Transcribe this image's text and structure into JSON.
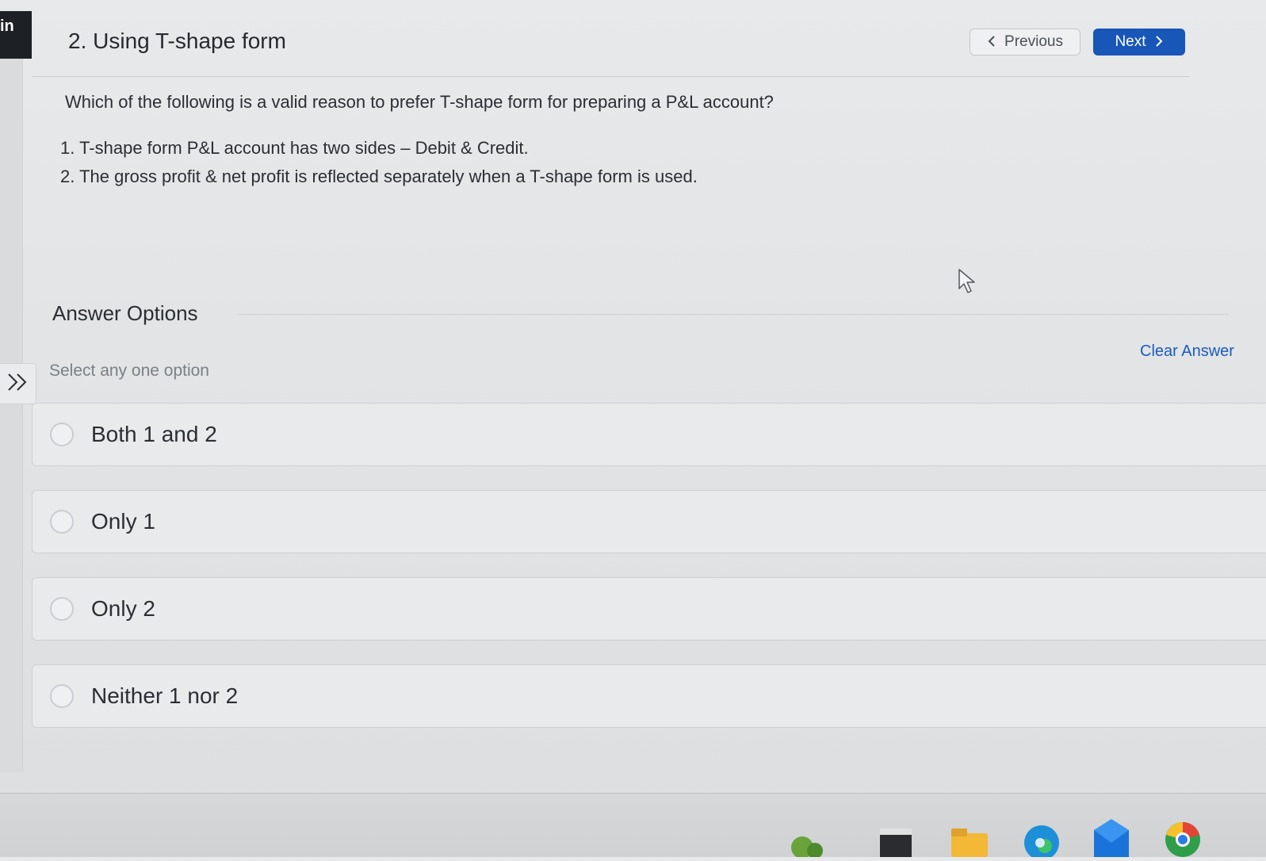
{
  "left_badge": {
    "text": "in"
  },
  "header": {
    "title": "2. Using T-shape form",
    "previous_label": "Previous",
    "next_label": "Next"
  },
  "question": {
    "text": "Which of the following is a valid reason to prefer T-shape form for preparing a P&L account?",
    "statements": [
      "1. T-shape form P&L account has two sides – Debit & Credit.",
      "2. The gross profit & net profit is reflected separately when a T-shape form is used."
    ]
  },
  "answers": {
    "heading": "Answer Options",
    "hint": "Select any one option",
    "clear_label": "Clear Answer",
    "options": [
      {
        "label": "Both 1 and 2",
        "selected": false
      },
      {
        "label": "Only 1",
        "selected": false
      },
      {
        "label": "Only 2",
        "selected": false
      },
      {
        "label": "Neither 1 nor 2",
        "selected": false
      }
    ]
  },
  "colors": {
    "accent": "#1856b8",
    "link": "#1a5bbd"
  },
  "icons": {
    "prev": "chevron-left-icon",
    "next": "chevron-right-icon",
    "expand": "double-chevron-right-icon",
    "cursor": "mouse-pointer-icon"
  },
  "taskbar": {
    "icons": [
      "widget-icon",
      "terminal-icon",
      "file-explorer-icon",
      "edge-browser-icon",
      "mail-icon",
      "chrome-icon"
    ]
  }
}
